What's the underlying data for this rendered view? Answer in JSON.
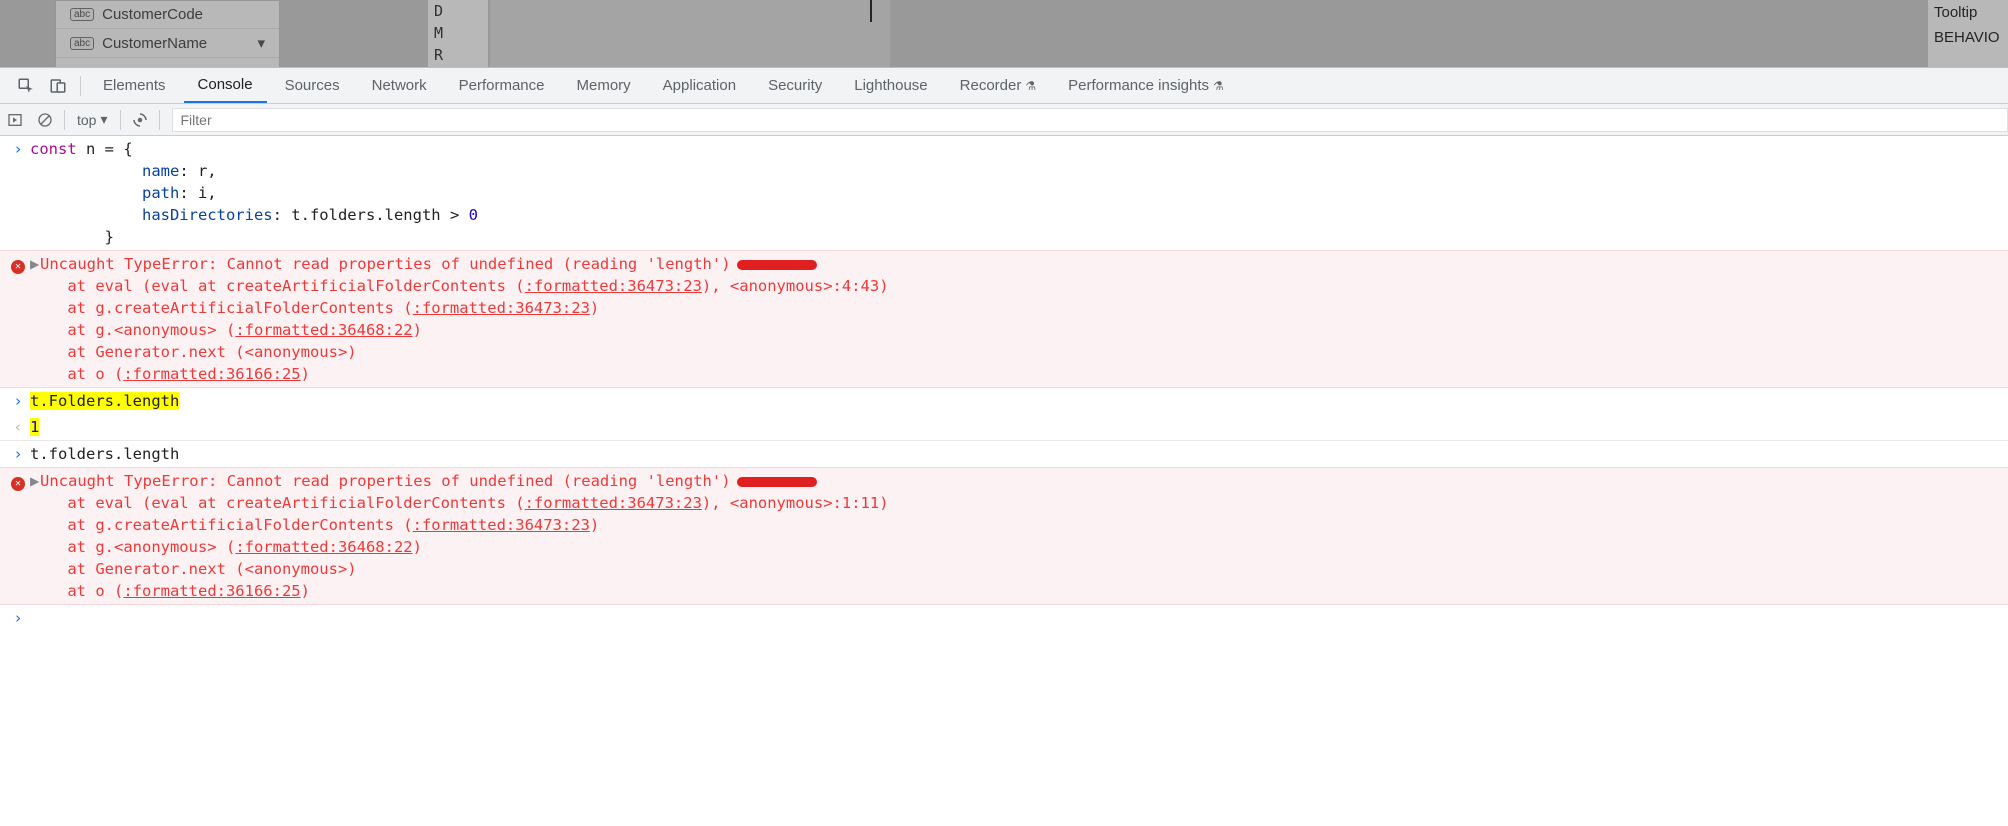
{
  "dim": {
    "field1": "CustomerCode",
    "field2": "CustomerName",
    "abc": "abc",
    "initials": [
      "D",
      "M",
      "R"
    ],
    "right1": "Tooltip",
    "right2": "BEHAVIO"
  },
  "tabs": {
    "elements": "Elements",
    "console": "Console",
    "sources": "Sources",
    "network": "Network",
    "performance": "Performance",
    "memory": "Memory",
    "application": "Application",
    "security": "Security",
    "lighthouse": "Lighthouse",
    "recorder": "Recorder",
    "perf_insights": "Performance insights"
  },
  "toolbar": {
    "context": "top",
    "filter_placeholder": "Filter"
  },
  "console": {
    "input1": {
      "l1": "const n = {",
      "l2": "            name: r,",
      "l3": "            path: i,",
      "l4": "            hasDirectories: t.folders.length > 0",
      "l5": "        }"
    },
    "err1": {
      "head": "Uncaught TypeError: Cannot read properties of undefined (reading 'length')",
      "t1a": "    at eval (eval at createArtificialFolderContents (",
      "t1b": ":formatted:36473:23",
      "t1c": "), <anonymous>:4:43)",
      "t2a": "    at g.createArtificialFolderContents (",
      "t2b": ":formatted:36473:23",
      "t2c": ")",
      "t3a": "    at g.<anonymous> (",
      "t3b": ":formatted:36468:22",
      "t3c": ")",
      "t4": "    at Generator.next (<anonymous>)",
      "t5a": "    at o (",
      "t5b": ":formatted:36166:25",
      "t5c": ")"
    },
    "input2": "t.Folders.length",
    "output2": "1",
    "input3": "t.folders.length",
    "err2": {
      "head": "Uncaught TypeError: Cannot read properties of undefined (reading 'length')",
      "t1a": "    at eval (eval at createArtificialFolderContents (",
      "t1b": ":formatted:36473:23",
      "t1c": "), <anonymous>:1:11)",
      "t2a": "    at g.createArtificialFolderContents (",
      "t2b": ":formatted:36473:23",
      "t2c": ")",
      "t3a": "    at g.<anonymous> (",
      "t3b": ":formatted:36468:22",
      "t3c": ")",
      "t4": "    at Generator.next (<anonymous>)",
      "t5a": "    at o (",
      "t5b": ":formatted:36166:25",
      "t5c": ")"
    }
  }
}
